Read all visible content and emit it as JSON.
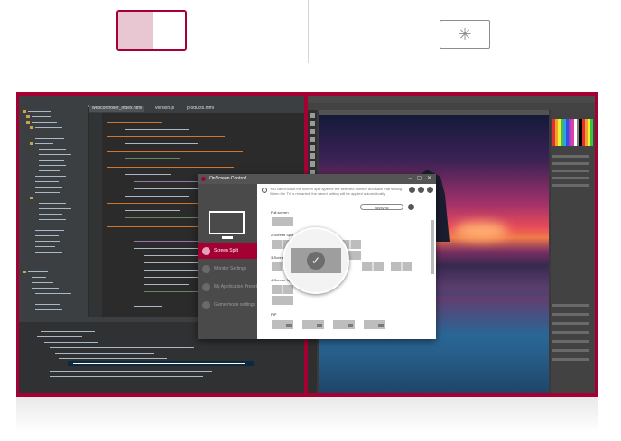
{
  "top_options": {
    "split_icon_name": "split-screen-icon",
    "single_icon_name": "full-screen-icon",
    "accent": "#a50034"
  },
  "osc": {
    "window_title": "OnScreen Control",
    "description": "You can choose the screen split type for the selected monitor and save that setting. When the TV is restarted, the saved setting will be applied automatically.",
    "apply_label": "Apply all",
    "nav": [
      {
        "label": "Screen Split"
      },
      {
        "label": "Monitor Settings"
      },
      {
        "label": "My Application Preset"
      },
      {
        "label": "Game mode settings"
      }
    ],
    "sections": {
      "full": "Full screen",
      "two": "2-Screen Split",
      "three": "3-Screen Split",
      "four": "4-Screen Split",
      "pip": "PIP"
    }
  },
  "ide": {
    "tabs": [
      "webcontroller_index.html",
      "version.js",
      "products.html"
    ]
  },
  "photoshop": {
    "panel_colors": [
      "#e03030",
      "#f0a030",
      "#f0f030",
      "#40c040",
      "#30a0e0",
      "#3050e0",
      "#a040d0"
    ]
  }
}
